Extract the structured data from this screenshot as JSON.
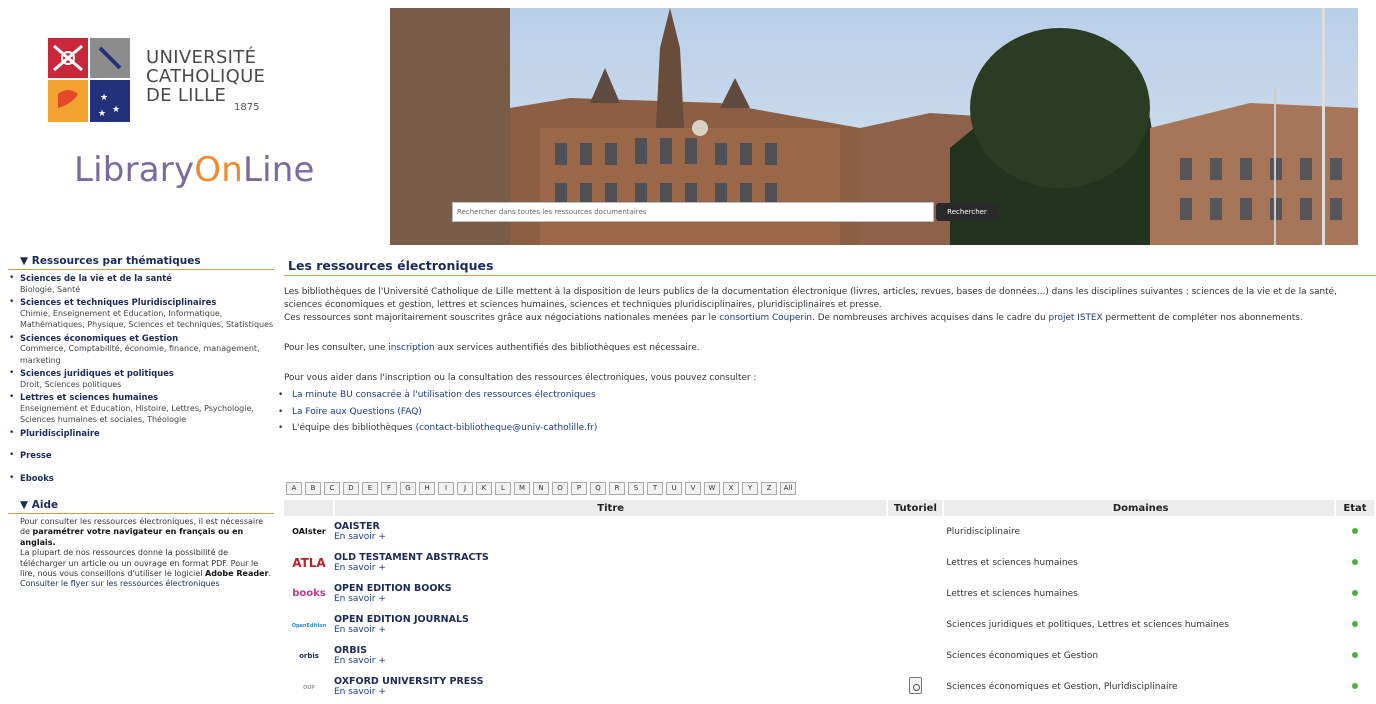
{
  "header": {
    "university_line1": "UNIVERSITÉ",
    "university_line2": "CATHOLIQUE",
    "university_line3": "DE LILLE",
    "university_year": "1875",
    "brand_part1": "Library",
    "brand_part2": "On",
    "brand_part3": "Line",
    "search_placeholder": "Rechercher dans toutes les ressources documentaires",
    "search_button": "Rechercher"
  },
  "sidebar": {
    "heading": "▼ Ressources par thématiques",
    "categories": [
      {
        "title": "Sciences de la vie et de la santé",
        "sub": "Biologie, Santé"
      },
      {
        "title": "Sciences et techniques Pluridisciplinaires",
        "sub": "Chimie, Enseignement et Education, Informatique, Mathématiques, Physique, Sciences et techniques, Statistiques"
      },
      {
        "title": "Sciences économiques et Gestion",
        "sub": "Commerce, Comptabilité, économie, finance, management, marketing"
      },
      {
        "title": "Sciences juridiques et politiques",
        "sub": "Droit, Sciences politiques"
      },
      {
        "title": "Lettres et sciences humaines",
        "sub": "Enseignement et Education, Histoire, Lettres, Psychologie, Sciences humaines et sociales, Théologie"
      },
      {
        "title": "Pluridisciplinaire",
        "sub": ""
      },
      {
        "title": "Presse",
        "sub": ""
      },
      {
        "title": "Ebooks",
        "sub": ""
      }
    ],
    "aide_heading": "▼ Aide",
    "aide_p1_a": "Pour consulter les ressources électroniques, il est nécessaire de ",
    "aide_p1_b": "paramétrer votre navigateur en français ou en anglais.",
    "aide_p2_a": "La plupart de nos ressources donne la possibilité de télécharger un article ou un ouvrage en format PDF. Pour le lire, nous vous conseillons d'utiliser le logiciel ",
    "aide_p2_b": "Adobe Reader",
    "aide_p2_c": ".",
    "aide_link": "Consulter le flyer sur les ressources électroniques"
  },
  "main": {
    "title": "Les ressources électroniques",
    "intro": "Les bibliothèques de l'Université Catholique de Lille mettent à la disposition de leurs publics de la documentation électronique (livres, articles, revues, bases de données...) dans les disciplines suivantes : sciences de la vie et de la santé, sciences économiques et gestion, lettres et sciences humaines, sciences et techniques pluridisciplinaires,  pluridisciplinaires et presse.",
    "p2_a": "Ces ressources sont majoritairement souscrites grâce aux négociations nationales menées par le ",
    "p2_link1": "consortium Couperin",
    "p2_b": ". De nombreuses archives acquises dans le cadre du ",
    "p2_link2": "projet ISTEX",
    "p2_c": " permettent de compléter nos abonnements.",
    "p3_a": "Pour les consulter, une ",
    "p3_link": "inscription",
    "p3_b": " aux services authentifiés des bibliothèques est nécessaire.",
    "p4": "Pour vous aider dans l'inscription ou la consultation des ressources électroniques, vous pouvez consulter :",
    "help_links": [
      {
        "text": "La minute BU consacrée à l'utilisation des ressources électroniques",
        "suffix": ""
      },
      {
        "text": "La Foire aux Questions (FAQ)",
        "suffix": ""
      },
      {
        "text": "L'équipe des bibliothèques ",
        "suffix": "(contact-bibliotheque@univ-catholille.fr)"
      }
    ]
  },
  "alphabet": [
    "A",
    "B",
    "C",
    "D",
    "E",
    "F",
    "G",
    "H",
    "I",
    "J",
    "K",
    "L",
    "M",
    "N",
    "O",
    "P",
    "Q",
    "R",
    "S",
    "T",
    "U",
    "V",
    "W",
    "X",
    "Y",
    "Z",
    "All"
  ],
  "table": {
    "headers": {
      "titre": "Titre",
      "tutoriel": "Tutoriel",
      "domaines": "Domaines",
      "etat": "Etat"
    },
    "rows": [
      {
        "logo": "OAIster",
        "title": "OAISTER",
        "more": "En savoir +",
        "domains": "Pluridisciplinaire",
        "tutorial": false
      },
      {
        "logo": "ATLA",
        "title": "OLD TESTAMENT ABSTRACTS",
        "more": "En savoir +",
        "domains": "Lettres et sciences humaines",
        "tutorial": false
      },
      {
        "logo": "books",
        "title": "OPEN EDITION BOOKS",
        "more": "En savoir +",
        "domains": "Lettres et sciences humaines",
        "tutorial": false
      },
      {
        "logo": "OpenEdition",
        "title": "OPEN EDITION JOURNALS",
        "more": "En savoir +",
        "domains": "Sciences juridiques et politiques, Lettres et sciences humaines",
        "tutorial": false
      },
      {
        "logo": "orbis",
        "title": "ORBIS",
        "more": "En savoir +",
        "domains": "Sciences économiques et Gestion",
        "tutorial": false
      },
      {
        "logo": "OUP",
        "title": "OXFORD UNIVERSITY PRESS",
        "more": "En savoir +",
        "domains": "Sciences économiques et Gestion, Pluridisciplinaire",
        "tutorial": true
      }
    ]
  },
  "colors": {
    "navy": "#1b2a5a",
    "gold": "#c9a04a",
    "status_ok": "#4caf3f",
    "brand_purple": "#7a6aa0",
    "brand_orange": "#f08a2c"
  }
}
